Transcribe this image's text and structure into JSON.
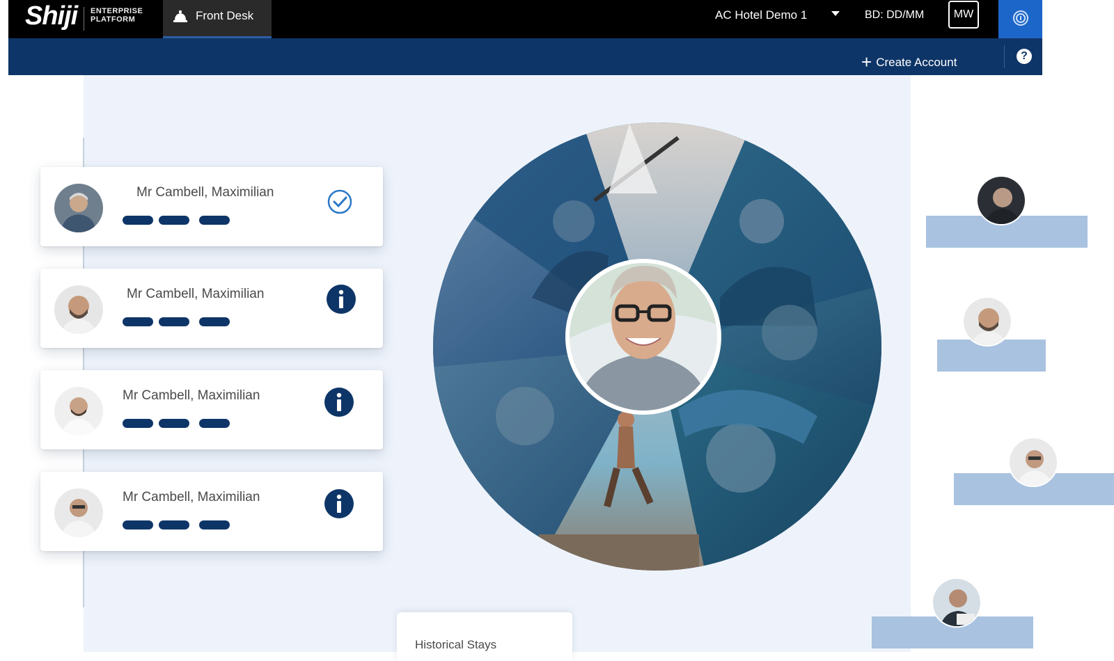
{
  "header": {
    "brand": "Shiji",
    "brand_sub_line1": "ENTERPRISE",
    "brand_sub_line2": "PLATFORM",
    "active_tab": "Front Desk",
    "hotel": "AC Hotel Demo 1",
    "business_date": "BD: DD/MM",
    "user_initials": "MW"
  },
  "subbar": {
    "create_account": "Create Account",
    "help": "?"
  },
  "guests": [
    {
      "name": "Mr Cambell, Maximilian",
      "status": "checked-icon"
    },
    {
      "name": "Mr Cambell, Maximilian",
      "status": "info-icon"
    },
    {
      "name": "Mr Cambell, Maximilian",
      "status": "info-icon"
    },
    {
      "name": "Mr Cambell, Maximilian",
      "status": "info-icon"
    }
  ],
  "panels": {
    "historical_stays": "Historical Stays"
  },
  "colors": {
    "navy": "#0e3567",
    "accent_blue": "#1c66c9",
    "background": "#eef3fb",
    "rail_bar": "#a9c2e0"
  }
}
